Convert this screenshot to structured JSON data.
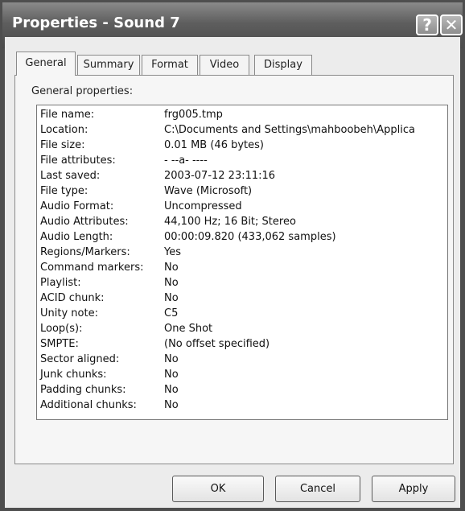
{
  "window": {
    "title": "Properties - Sound 7"
  },
  "titlebar": {
    "help_glyph": "?",
    "close_glyph": "✕"
  },
  "tabs": [
    {
      "label": "General",
      "active": true
    },
    {
      "label": "Summary"
    },
    {
      "label": "Format"
    },
    {
      "label": "Video"
    },
    {
      "label": "Display"
    }
  ],
  "general": {
    "group_label": "General properties:",
    "properties": [
      {
        "key": "File name:",
        "value": "frg005.tmp"
      },
      {
        "key": "Location:",
        "value": "C:\\Documents and Settings\\mahboobeh\\Applica"
      },
      {
        "key": "File size:",
        "value": "0.01 MB (46 bytes)"
      },
      {
        "key": "File attributes:",
        "value": "- --a- ----"
      },
      {
        "key": "Last saved:",
        "value": "2003-07-12  23:11:16"
      },
      {
        "key": "File type:",
        "value": "Wave (Microsoft)"
      },
      {
        "key": "Audio Format:",
        "value": "Uncompressed"
      },
      {
        "key": "Audio Attributes:",
        "value": "44,100 Hz; 16 Bit; Stereo"
      },
      {
        "key": "Audio Length:",
        "value": "00:00:09.820 (433,062 samples)"
      },
      {
        "key": "Regions/Markers:",
        "value": "Yes"
      },
      {
        "key": "Command markers:",
        "value": "No"
      },
      {
        "key": "Playlist:",
        "value": "No"
      },
      {
        "key": "ACID chunk:",
        "value": "No"
      },
      {
        "key": "Unity note:",
        "value": "C5"
      },
      {
        "key": "Loop(s):",
        "value": "One Shot"
      },
      {
        "key": "SMPTE:",
        "value": "(No offset specified)"
      },
      {
        "key": "Sector aligned:",
        "value": "No"
      },
      {
        "key": "Junk chunks:",
        "value": "No"
      },
      {
        "key": "Padding chunks:",
        "value": "No"
      },
      {
        "key": "Additional chunks:",
        "value": "No"
      }
    ]
  },
  "buttons": {
    "ok": "OK",
    "cancel": "Cancel",
    "apply": "Apply"
  }
}
